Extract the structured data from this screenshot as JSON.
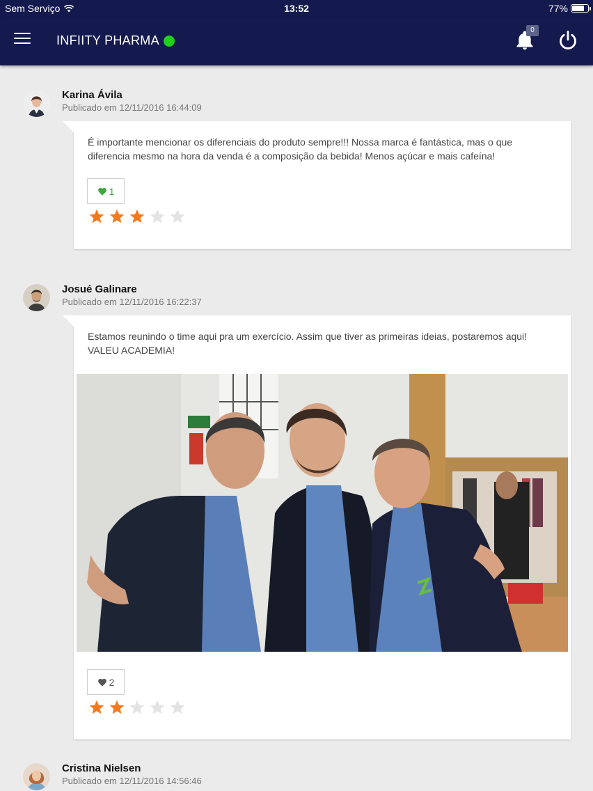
{
  "status_bar": {
    "carrier": "Sem Serviço",
    "time": "13:52",
    "battery": "77%",
    "battery_level": 0.77
  },
  "app_bar": {
    "title": "INFIITY PHARMA",
    "status_color": "#1fd01f",
    "menu_icon": "hamburger-menu-icon",
    "notifications_icon": "bell-icon",
    "notifications_count": "0",
    "power_icon": "power-icon",
    "background": "#141a4e"
  },
  "posts": [
    {
      "author": "Karina Ávila",
      "published": "Publicado em 12/11/2016 16:44:09",
      "text": "É importante mencionar os diferenciais do produto sempre!!! Nossa marca é fantástica, mas o que diferencia mesmo na hora da venda é a composição da bebida! Menos açúcar e mais cafeína!",
      "likes": "1",
      "liked": true,
      "rating": 3,
      "rating_max": 5,
      "has_photo": false
    },
    {
      "author": "Josué Galinare",
      "published": "Publicado em 12/11/2016 16:22:37",
      "text": "Estamos reunindo o time aqui pra um exercício. Assim que tiver as primeiras ideias, postaremos aqui! VALEU ACADEMIA!",
      "likes": "2",
      "liked": false,
      "rating": 2,
      "rating_max": 5,
      "has_photo": true
    },
    {
      "author": "Cristina Nielsen",
      "published": "Publicado em 12/11/2016 14:56:46"
    }
  ],
  "colors": {
    "star_active": "#f47a1c",
    "star_inactive": "#e3e3e3",
    "heart_liked": "#3caa3c",
    "heart_default": "#555555"
  }
}
